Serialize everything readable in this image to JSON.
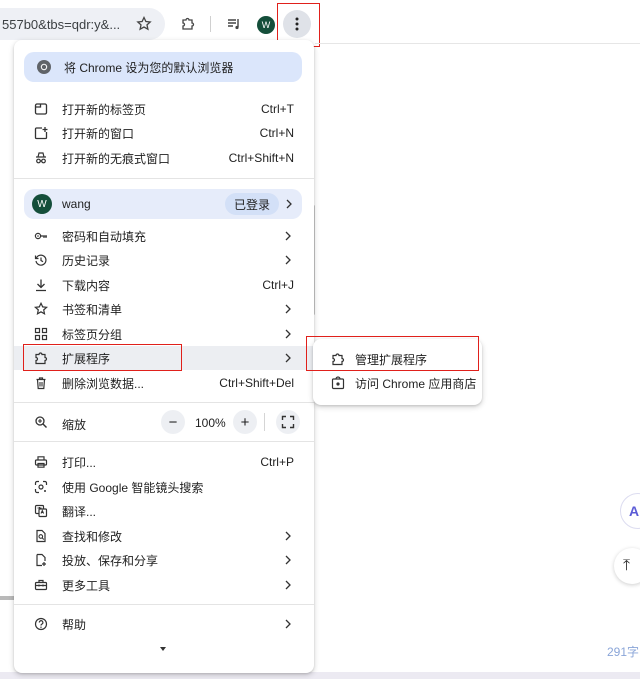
{
  "toolbar": {
    "url_fragment": "557b0&tbs=qdr:y&...",
    "avatar_letter": "W"
  },
  "menu": {
    "set_default": "将 Chrome 设为您的默认浏览器",
    "group1": [
      {
        "label": "打开新的标签页",
        "shortcut": "Ctrl+T",
        "icon": "new-tab-icon"
      },
      {
        "label": "打开新的窗口",
        "shortcut": "Ctrl+N",
        "icon": "new-window-icon"
      },
      {
        "label": "打开新的无痕式窗口",
        "shortcut": "Ctrl+Shift+N",
        "icon": "incognito-icon"
      }
    ],
    "profile": {
      "letter": "W",
      "name": "wang",
      "status": "已登录"
    },
    "group2": [
      {
        "label": "密码和自动填充",
        "icon": "key-icon",
        "submenu": true
      },
      {
        "label": "历史记录",
        "icon": "history-icon",
        "submenu": true
      },
      {
        "label": "下载内容",
        "shortcut": "Ctrl+J",
        "icon": "download-icon"
      },
      {
        "label": "书签和清单",
        "icon": "star-icon",
        "submenu": true
      },
      {
        "label": "标签页分组",
        "icon": "tab-groups-icon",
        "submenu": true
      },
      {
        "label": "扩展程序",
        "icon": "extension-icon",
        "submenu": true
      },
      {
        "label": "删除浏览数据...",
        "shortcut": "Ctrl+Shift+Del",
        "icon": "trash-icon"
      }
    ],
    "zoom": {
      "label": "缩放",
      "minus": "−",
      "value": "100%",
      "plus": "+"
    },
    "group3": [
      {
        "label": "打印...",
        "shortcut": "Ctrl+P",
        "icon": "print-icon"
      },
      {
        "label": "使用 Google 智能镜头搜索",
        "icon": "lens-icon"
      },
      {
        "label": "翻译...",
        "icon": "translate-icon"
      },
      {
        "label": "查找和修改",
        "icon": "find-icon",
        "submenu": true
      },
      {
        "label": "投放、保存和分享",
        "icon": "cast-save-share-icon",
        "submenu": true
      },
      {
        "label": "更多工具",
        "icon": "toolbox-icon",
        "submenu": true
      }
    ],
    "help": {
      "label": "帮助",
      "icon": "help-icon"
    }
  },
  "submenu": [
    {
      "label": "管理扩展程序",
      "icon": "extension-icon"
    },
    {
      "label": "访问 Chrome 应用商店",
      "icon": "webstore-icon"
    }
  ],
  "page": {
    "side_button_label": "A",
    "back_to_top_glyph": "⤒",
    "word_count": "291字"
  },
  "colors": {
    "highlight_box": "#e0201b",
    "menu_banner": "#dbe6fb",
    "avatar": "#144e3a"
  }
}
